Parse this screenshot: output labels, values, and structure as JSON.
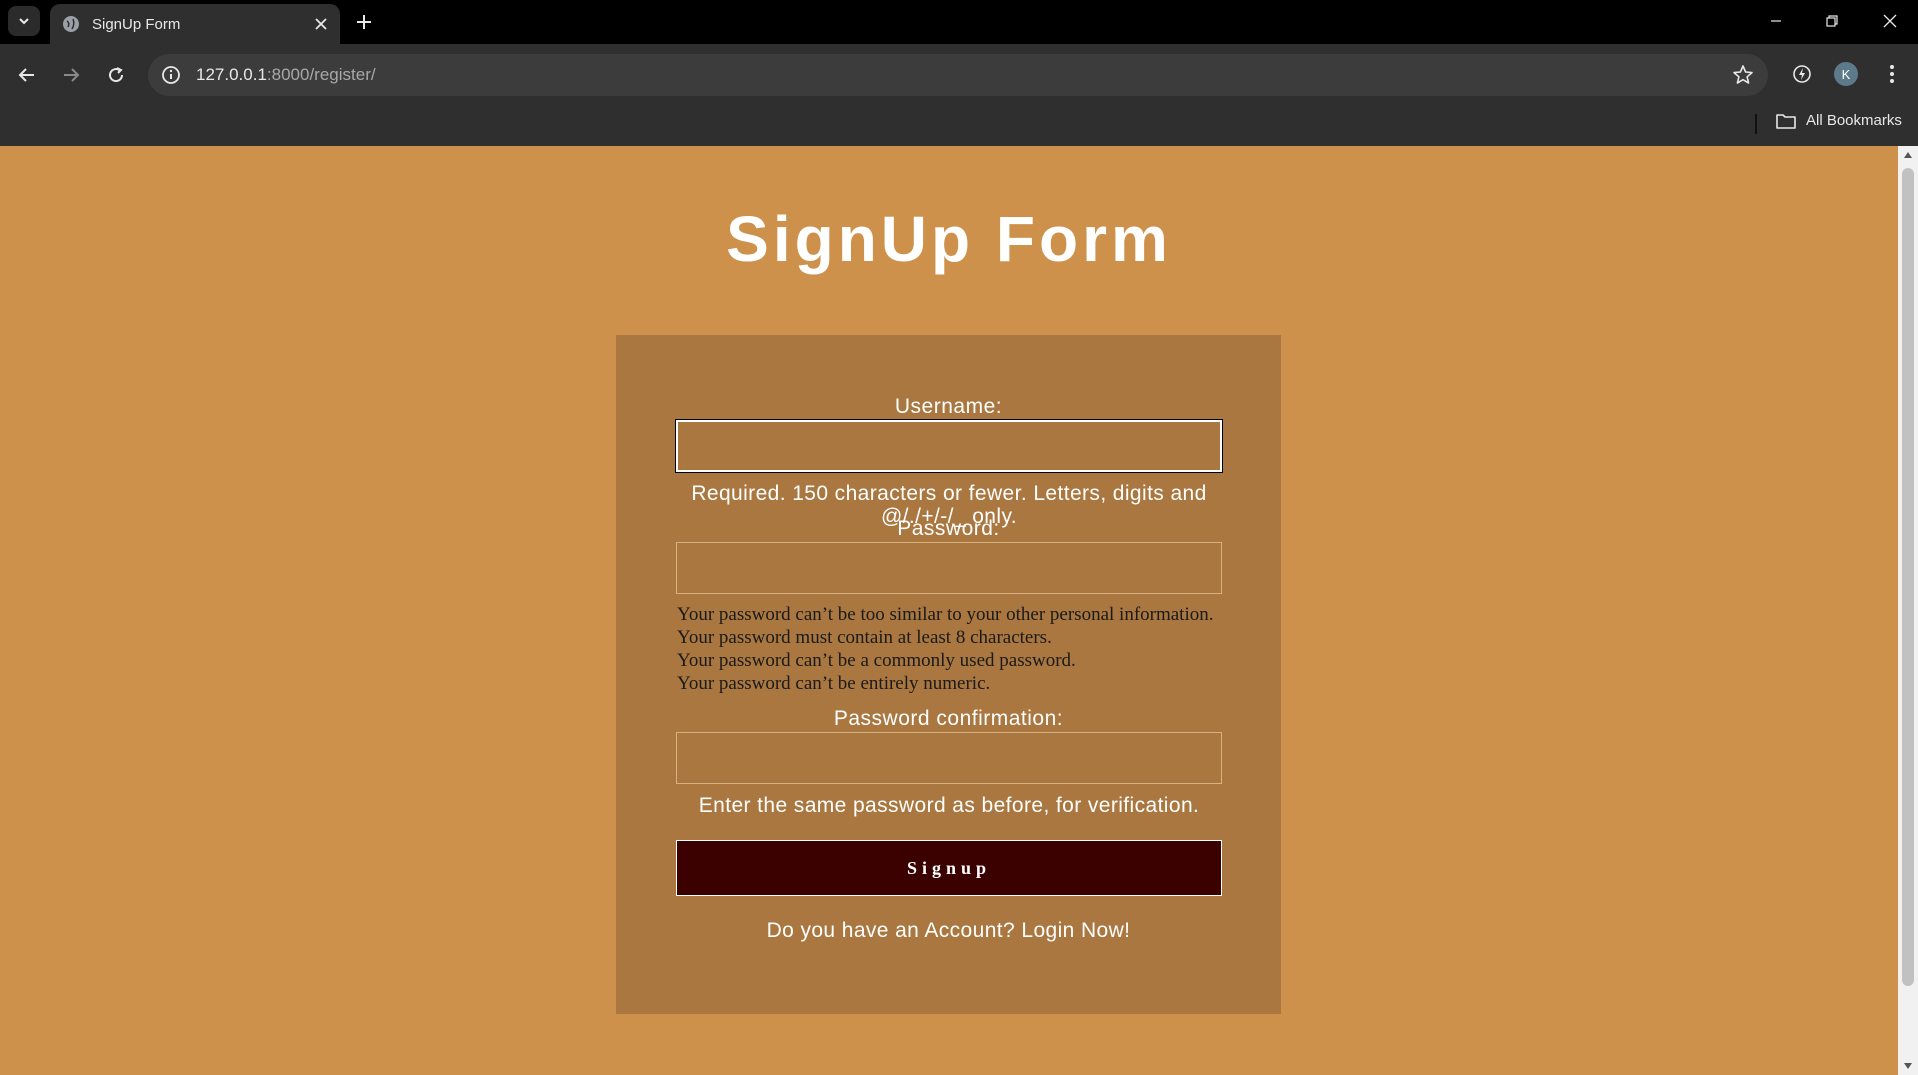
{
  "browser": {
    "tab": {
      "title": "SignUp Form"
    },
    "url": {
      "host": "127.0.0.1",
      "rest": ":8000/register/"
    },
    "avatar_letter": "K",
    "bookmarks_label": "All Bookmarks"
  },
  "page": {
    "title": "SignUp Form",
    "form": {
      "username": {
        "label": "Username:",
        "value": "",
        "help": "Required. 150 characters or fewer. Letters, digits and @/./+/-/_ only."
      },
      "password": {
        "label": "Password:",
        "value": "",
        "rules": [
          "Your password can’t be too similar to your other personal information.",
          "Your password must contain at least 8 characters.",
          "Your password can’t be a commonly used password.",
          "Your password can’t be entirely numeric."
        ]
      },
      "password_confirmation": {
        "label": "Password confirmation:",
        "value": "",
        "help": "Enter the same password as before, for verification."
      },
      "submit_label": "Signup",
      "account_prompt": "Do you have an Account?",
      "login_link": "Login Now!"
    }
  },
  "colors": {
    "page_bg": "#cd914b",
    "card_bg": "#a9773f",
    "button_bg": "#3b0000"
  }
}
